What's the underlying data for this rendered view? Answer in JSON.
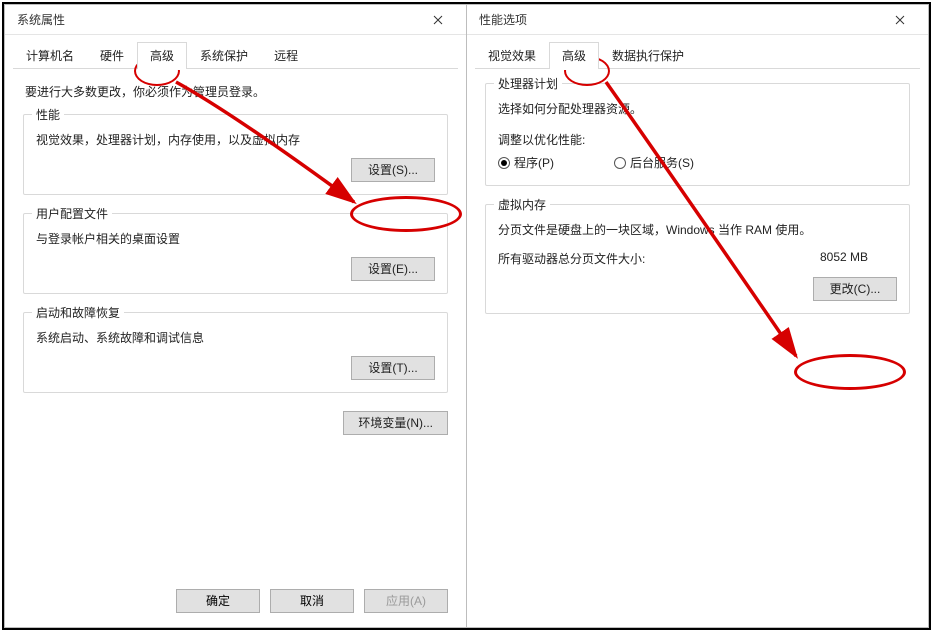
{
  "left": {
    "title": "系统属性",
    "tabs": [
      "计算机名",
      "硬件",
      "高级",
      "系统保护",
      "远程"
    ],
    "activeTab": 2,
    "adminNote": "要进行大多数更改，你必须作为管理员登录。",
    "perf": {
      "title": "性能",
      "desc": "视觉效果，处理器计划，内存使用，以及虚拟内存",
      "btn": "设置(S)..."
    },
    "profiles": {
      "title": "用户配置文件",
      "desc": "与登录帐户相关的桌面设置",
      "btn": "设置(E)..."
    },
    "startup": {
      "title": "启动和故障恢复",
      "desc": "系统启动、系统故障和调试信息",
      "btn": "设置(T)..."
    },
    "envBtn": "环境变量(N)...",
    "footer": {
      "ok": "确定",
      "cancel": "取消",
      "apply": "应用(A)"
    }
  },
  "right": {
    "title": "性能选项",
    "tabs": [
      "视觉效果",
      "高级",
      "数据执行保护"
    ],
    "activeTab": 1,
    "proc": {
      "title": "处理器计划",
      "desc": "选择如何分配处理器资源。",
      "optLabel": "调整以优化性能:",
      "opt1": "程序(P)",
      "opt2": "后台服务(S)"
    },
    "vmem": {
      "title": "虚拟内存",
      "desc": "分页文件是硬盘上的一块区域，Windows 当作 RAM 使用。",
      "totalLabel": "所有驱动器总分页文件大小:",
      "totalValue": "8052 MB",
      "btn": "更改(C)..."
    }
  }
}
